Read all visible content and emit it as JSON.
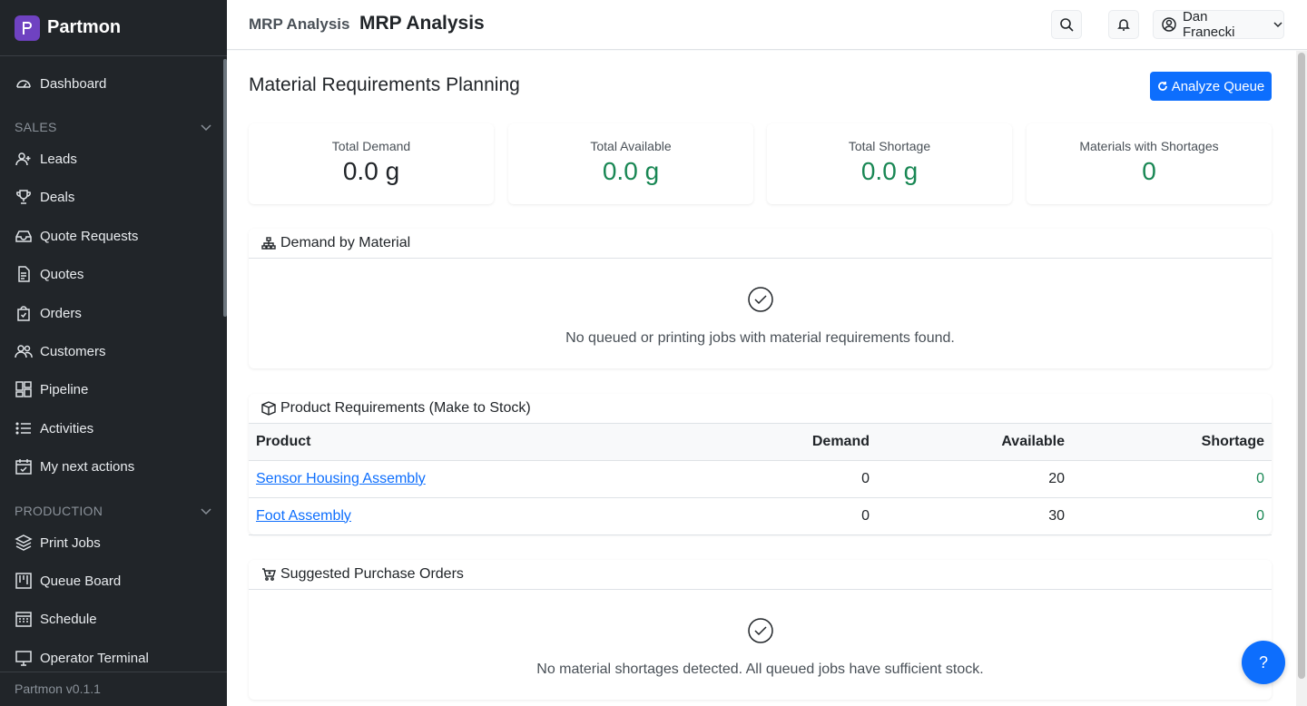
{
  "brand": {
    "name": "Partmon",
    "logo_icon": "partmon-logo-icon",
    "version": "Partmon v0.1.1"
  },
  "nav": {
    "dashboard": "Dashboard",
    "sales_section": "SALES",
    "sales": [
      "Leads",
      "Deals",
      "Quote Requests",
      "Quotes",
      "Orders",
      "Customers",
      "Pipeline",
      "Activities",
      "My next actions"
    ],
    "production_section": "PRODUCTION",
    "production": [
      "Print Jobs",
      "Queue Board",
      "Schedule",
      "Operator Terminal"
    ]
  },
  "header": {
    "breadcrumb": "MRP Analysis",
    "title": "MRP Analysis",
    "user_name": "Dan Franecki"
  },
  "page": {
    "heading": "Material Requirements Planning",
    "analyze_button": "Analyze Queue"
  },
  "stats": [
    {
      "label": "Total Demand",
      "value": "0.0 g",
      "color": "#212529"
    },
    {
      "label": "Total Available",
      "value": "0.0 g",
      "color": "#198754"
    },
    {
      "label": "Total Shortage",
      "value": "0.0 g",
      "color": "#198754"
    },
    {
      "label": "Materials with Shortages",
      "value": "0",
      "color": "#198754"
    }
  ],
  "demand_panel": {
    "title": "Demand by Material",
    "empty_text": "No queued or printing jobs with material requirements found."
  },
  "product_panel": {
    "title": "Product Requirements (Make to Stock)",
    "columns": [
      "Product",
      "Demand",
      "Available",
      "Shortage"
    ],
    "rows": [
      {
        "product": "Sensor Housing Assembly",
        "demand": "0",
        "available": "20",
        "shortage": "0"
      },
      {
        "product": "Foot Assembly",
        "demand": "0",
        "available": "30",
        "shortage": "0"
      }
    ]
  },
  "purchase_panel": {
    "title": "Suggested Purchase Orders",
    "empty_text": "No material shortages detected. All queued jobs have sufficient stock."
  },
  "help_label": "?",
  "colors": {
    "accent": "#0d6efd",
    "success": "#198754",
    "sidebar_bg": "#212529",
    "brand": "#6f42c1"
  }
}
